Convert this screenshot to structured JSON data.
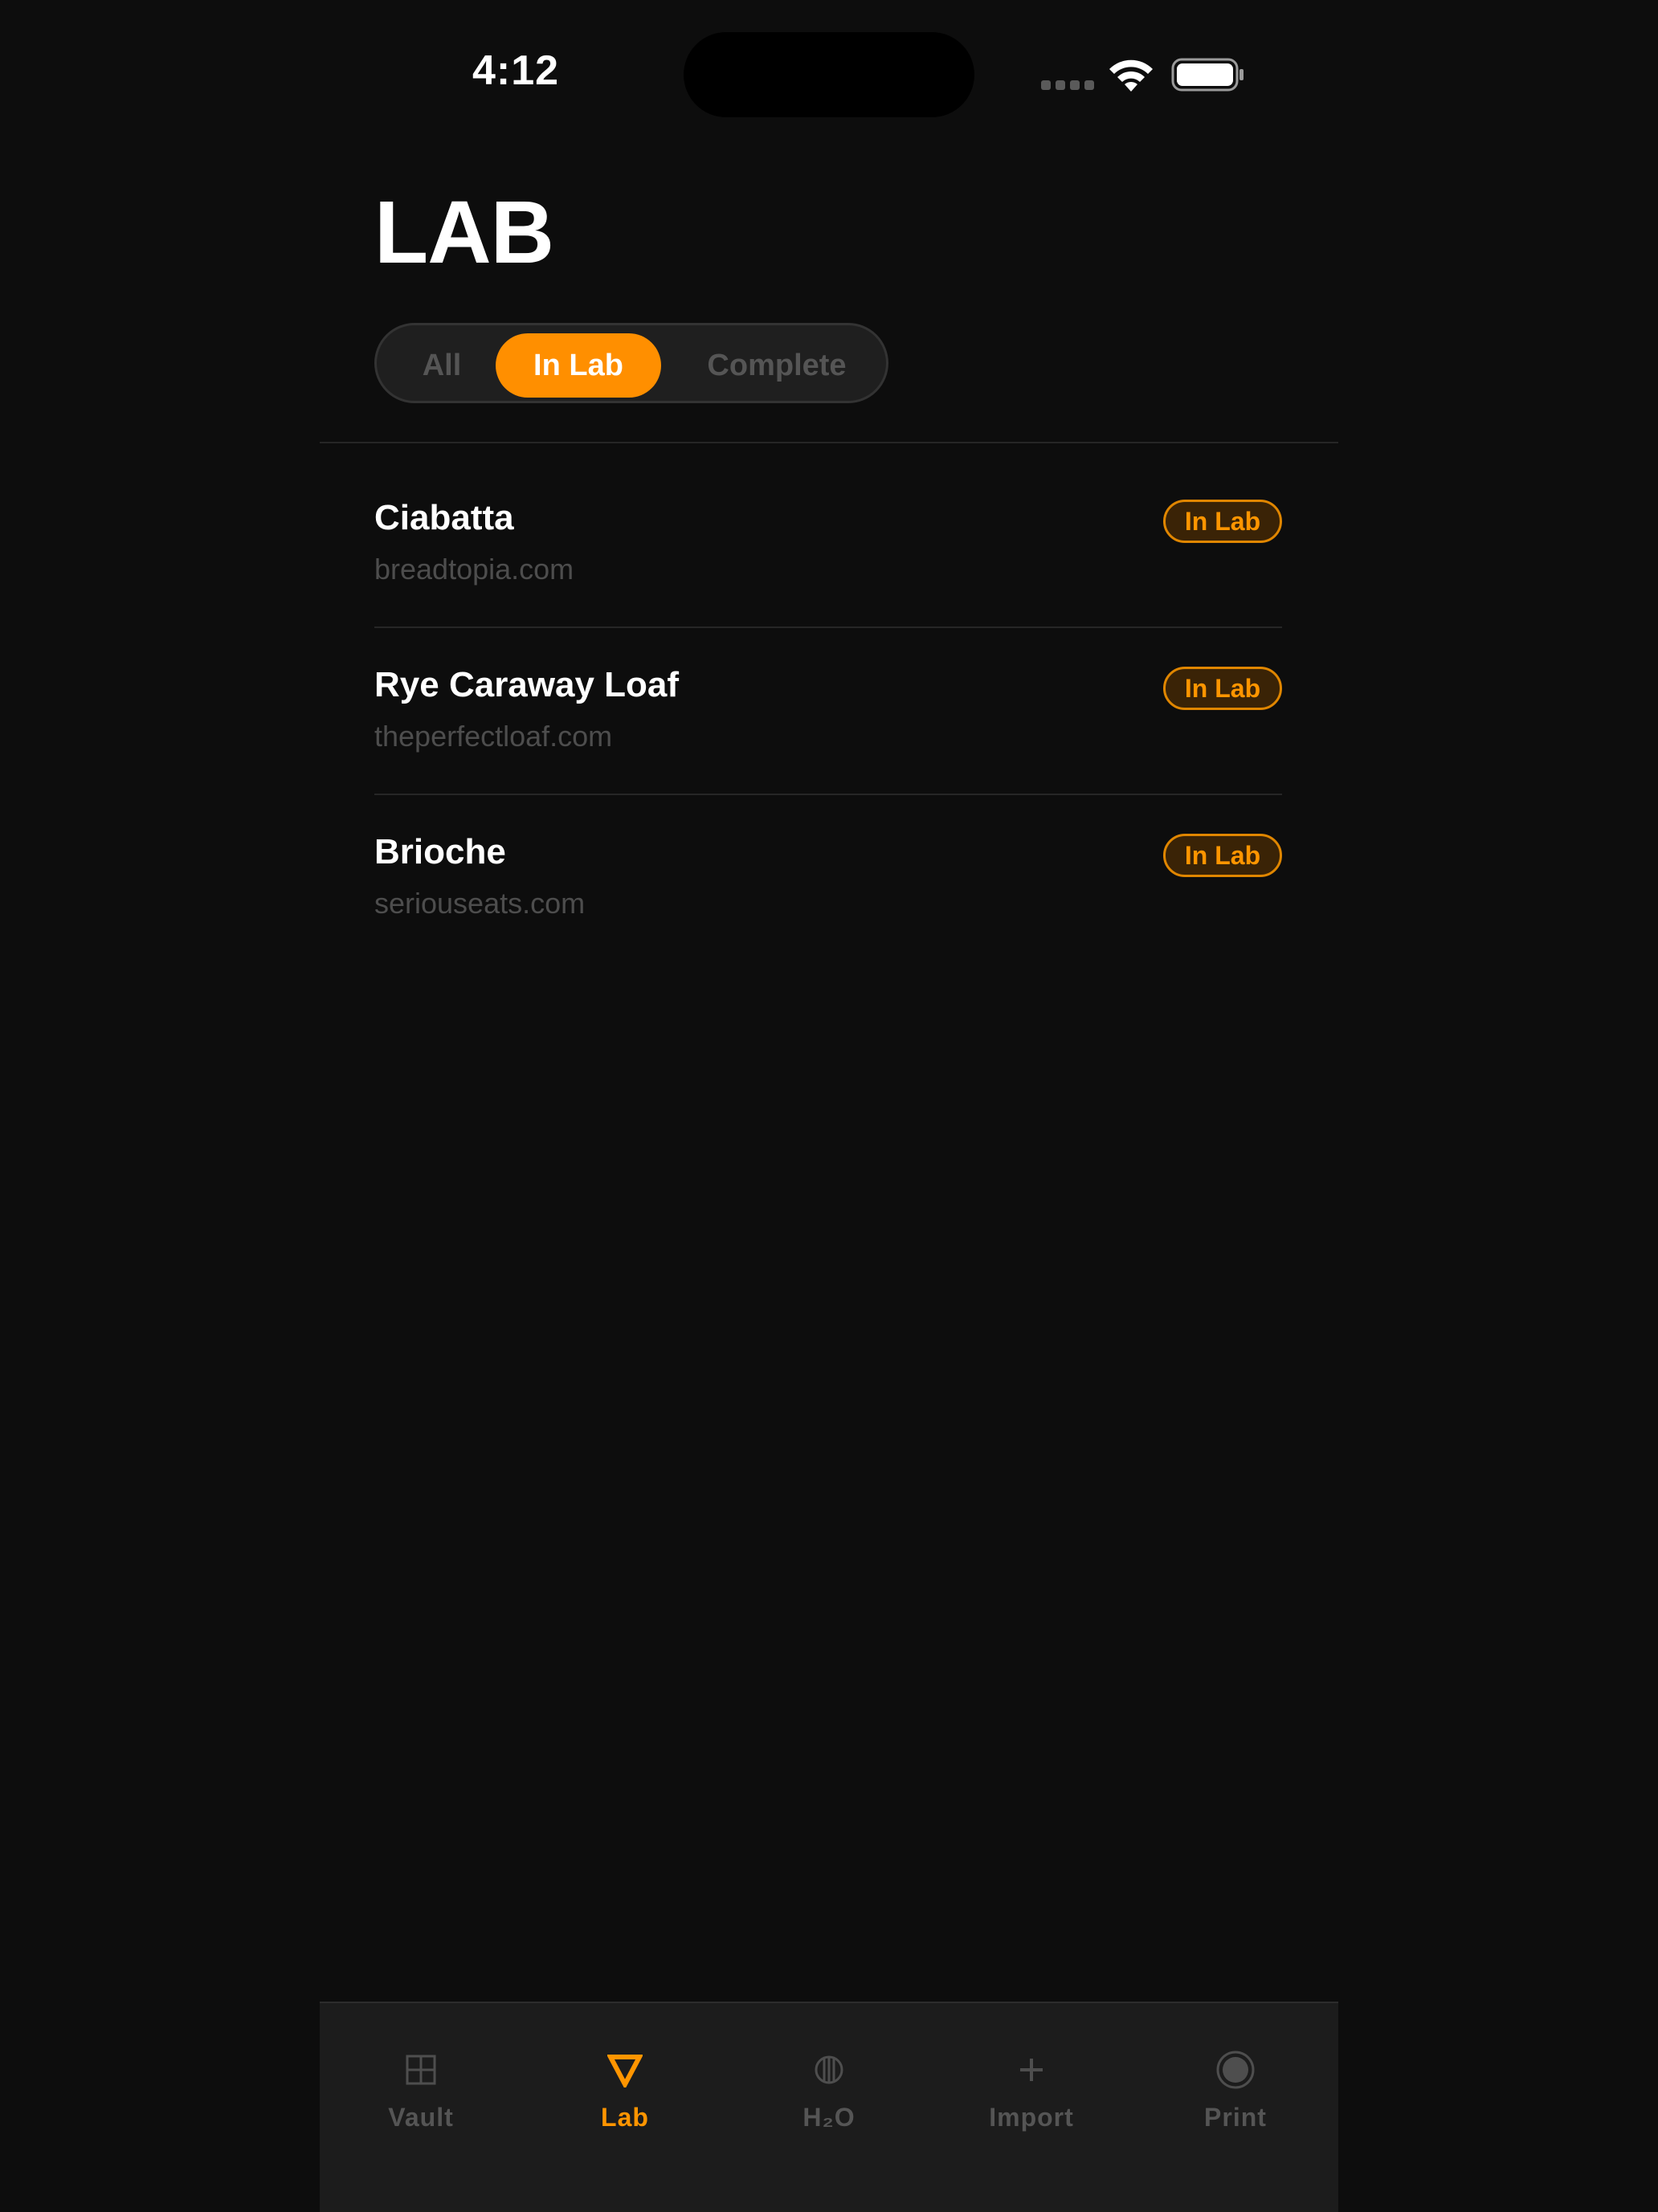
{
  "status_bar": {
    "time": "4:12"
  },
  "header": {
    "title": "LAB"
  },
  "filter": {
    "options": [
      "All",
      "In Lab",
      "Complete"
    ],
    "selected": "In Lab"
  },
  "recipes": [
    {
      "name": "Ciabatta",
      "source": "breadtopia.com",
      "status": "In Lab"
    },
    {
      "name": "Rye Caraway Loaf",
      "source": "theperfectloaf.com",
      "status": "In Lab"
    },
    {
      "name": "Brioche",
      "source": "seriouseats.com",
      "status": "In Lab"
    }
  ],
  "tabbar": {
    "tabs": [
      {
        "label": "Vault",
        "icon": "grid-icon"
      },
      {
        "label": "Lab",
        "icon": "triangle-down-icon"
      },
      {
        "label": "H₂O",
        "icon": "water-circle-icon"
      },
      {
        "label": "Import",
        "icon": "plus-icon"
      },
      {
        "label": "Print",
        "icon": "record-icon"
      }
    ],
    "active": "Lab"
  },
  "colors": {
    "accent": "#ff9500",
    "background": "#0d0d0d",
    "muted_text": "#555555"
  }
}
